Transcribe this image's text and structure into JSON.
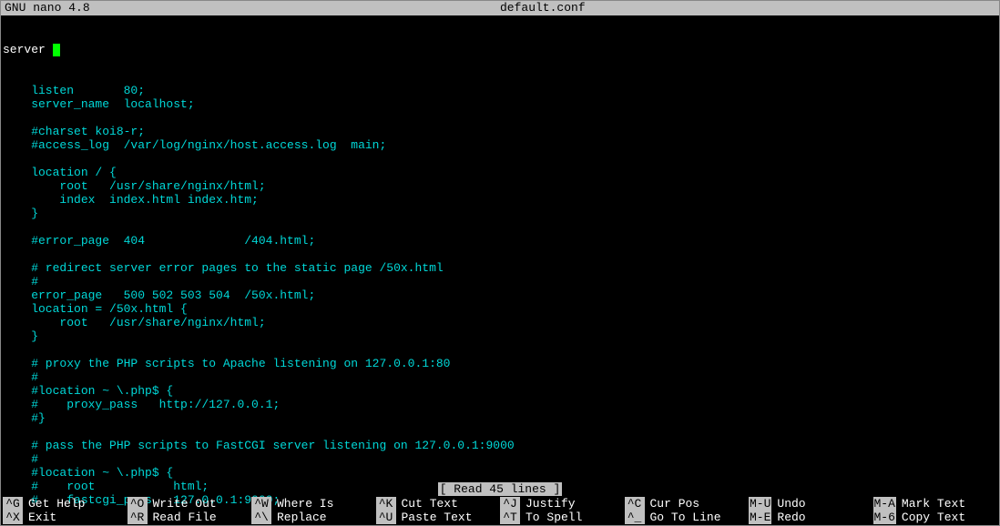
{
  "titlebar": {
    "app": "GNU nano 4.8",
    "filename": "default.conf"
  },
  "cursor_line_prefix": "server ",
  "lines": [
    "    listen       80;",
    "    server_name  localhost;",
    "",
    "    #charset koi8-r;",
    "    #access_log  /var/log/nginx/host.access.log  main;",
    "",
    "    location / {",
    "        root   /usr/share/nginx/html;",
    "        index  index.html index.htm;",
    "    }",
    "",
    "    #error_page  404              /404.html;",
    "",
    "    # redirect server error pages to the static page /50x.html",
    "    #",
    "    error_page   500 502 503 504  /50x.html;",
    "    location = /50x.html {",
    "        root   /usr/share/nginx/html;",
    "    }",
    "",
    "    # proxy the PHP scripts to Apache listening on 127.0.0.1:80",
    "    #",
    "    #location ~ \\.php$ {",
    "    #    proxy_pass   http://127.0.0.1;",
    "    #}",
    "",
    "    # pass the PHP scripts to FastCGI server listening on 127.0.0.1:9000",
    "    #",
    "    #location ~ \\.php$ {",
    "    #    root           html;",
    "    #    fastcgi_pass   127.0.0.1:9000;"
  ],
  "status": "[ Read 45 lines ]",
  "shortcuts": [
    {
      "key": "^G",
      "label": "Get Help"
    },
    {
      "key": "^O",
      "label": "Write Out"
    },
    {
      "key": "^W",
      "label": "Where Is"
    },
    {
      "key": "^K",
      "label": "Cut Text"
    },
    {
      "key": "^J",
      "label": "Justify"
    },
    {
      "key": "^C",
      "label": "Cur Pos"
    },
    {
      "key": "M-U",
      "label": "Undo"
    },
    {
      "key": "M-A",
      "label": "Mark Text"
    },
    {
      "key": "^X",
      "label": "Exit"
    },
    {
      "key": "^R",
      "label": "Read File"
    },
    {
      "key": "^\\",
      "label": "Replace"
    },
    {
      "key": "^U",
      "label": "Paste Text"
    },
    {
      "key": "^T",
      "label": "To Spell"
    },
    {
      "key": "^_",
      "label": "Go To Line"
    },
    {
      "key": "M-E",
      "label": "Redo"
    },
    {
      "key": "M-6",
      "label": "Copy Text"
    }
  ]
}
